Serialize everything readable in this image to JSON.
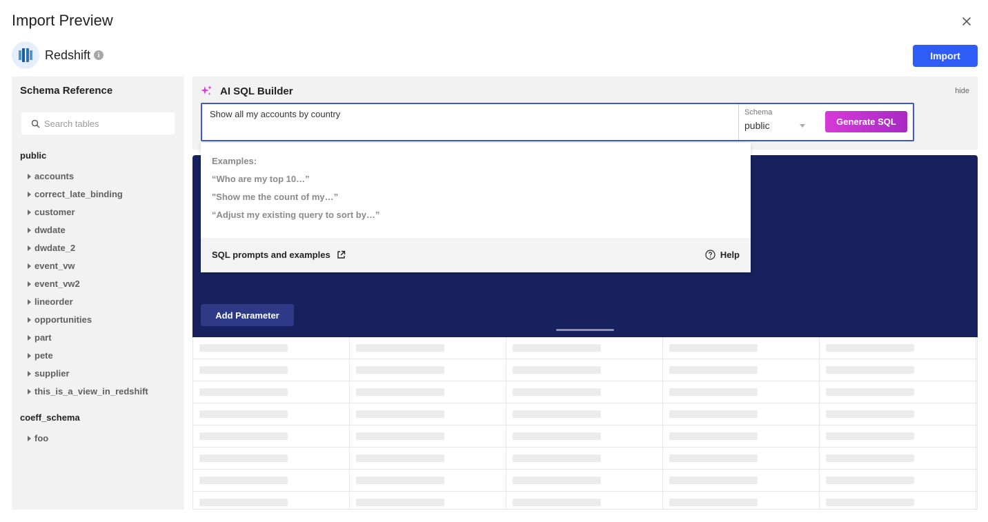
{
  "dialog": {
    "title": "Import Preview"
  },
  "connector": {
    "name": "Redshift",
    "logo": "redshift-logo-icon"
  },
  "actions": {
    "import_label": "Import"
  },
  "sidebar": {
    "title": "Schema Reference",
    "search_placeholder": "Search tables",
    "schemas": [
      {
        "name": "public",
        "tables": [
          "accounts",
          "correct_late_binding",
          "customer",
          "dwdate",
          "dwdate_2",
          "event_vw",
          "event_vw2",
          "lineorder",
          "opportunities",
          "part",
          "pete",
          "supplier",
          "this_is_a_view_in_redshift"
        ]
      },
      {
        "name": "coeff_schema",
        "tables": [
          "foo"
        ]
      }
    ]
  },
  "ai_builder": {
    "title": "AI SQL Builder",
    "hide_label": "hide",
    "prompt_value": "Show all my accounts by country",
    "schema_label": "Schema",
    "schema_value": "public",
    "generate_label": "Generate SQL",
    "accent_color": "#d63ad8"
  },
  "suggestions": {
    "heading": "Examples:",
    "examples": [
      "“Who are my top 10…”",
      "\"Show me the count of my…”",
      "“Adjust my existing query to sort by…”"
    ],
    "prompts_link": "SQL prompts and examples",
    "help_label": "Help"
  },
  "editor": {
    "add_parameter_label": "Add Parameter",
    "background_color": "#16215d"
  }
}
